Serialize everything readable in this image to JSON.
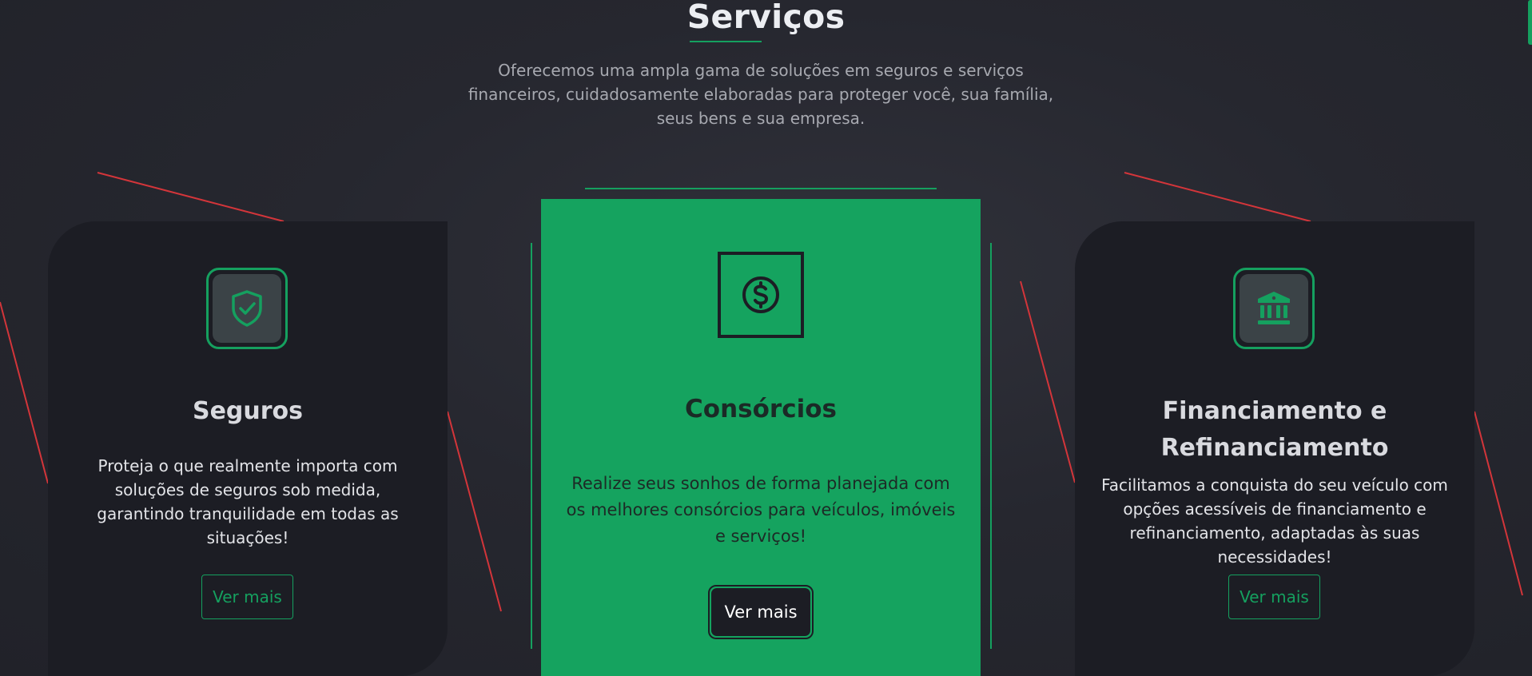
{
  "section": {
    "title": "Serviços",
    "description": "Oferecemos uma ampla gama de soluções em seguros e serviços financeiros, cuidadosamente elaboradas para proteger você, sua família, seus bens e sua empresa."
  },
  "colors": {
    "accent": "#15a05f",
    "card_background": "#1c1d24",
    "page_background": "#26272f",
    "deco_line": "#d3353a"
  },
  "cards": [
    {
      "icon": "shield-check-icon",
      "title": "Seguros",
      "text": "Proteja o que realmente importa com soluções de seguros sob medida, garantindo tranquilidade em todas as situações!",
      "button": "Ver mais"
    },
    {
      "icon": "dollar-circle-icon",
      "title": "Consórcios",
      "text": "Realize seus sonhos de forma planejada com os melhores consórcios para veículos, imóveis e serviços!",
      "button": "Ver mais"
    },
    {
      "icon": "bank-icon",
      "title": "Financiamento e Refinanciamento",
      "text": "Facilitamos a conquista do seu veículo com opções acessíveis de financiamento e refinanciamento, adaptadas às suas necessidades!",
      "button": "Ver mais"
    }
  ]
}
